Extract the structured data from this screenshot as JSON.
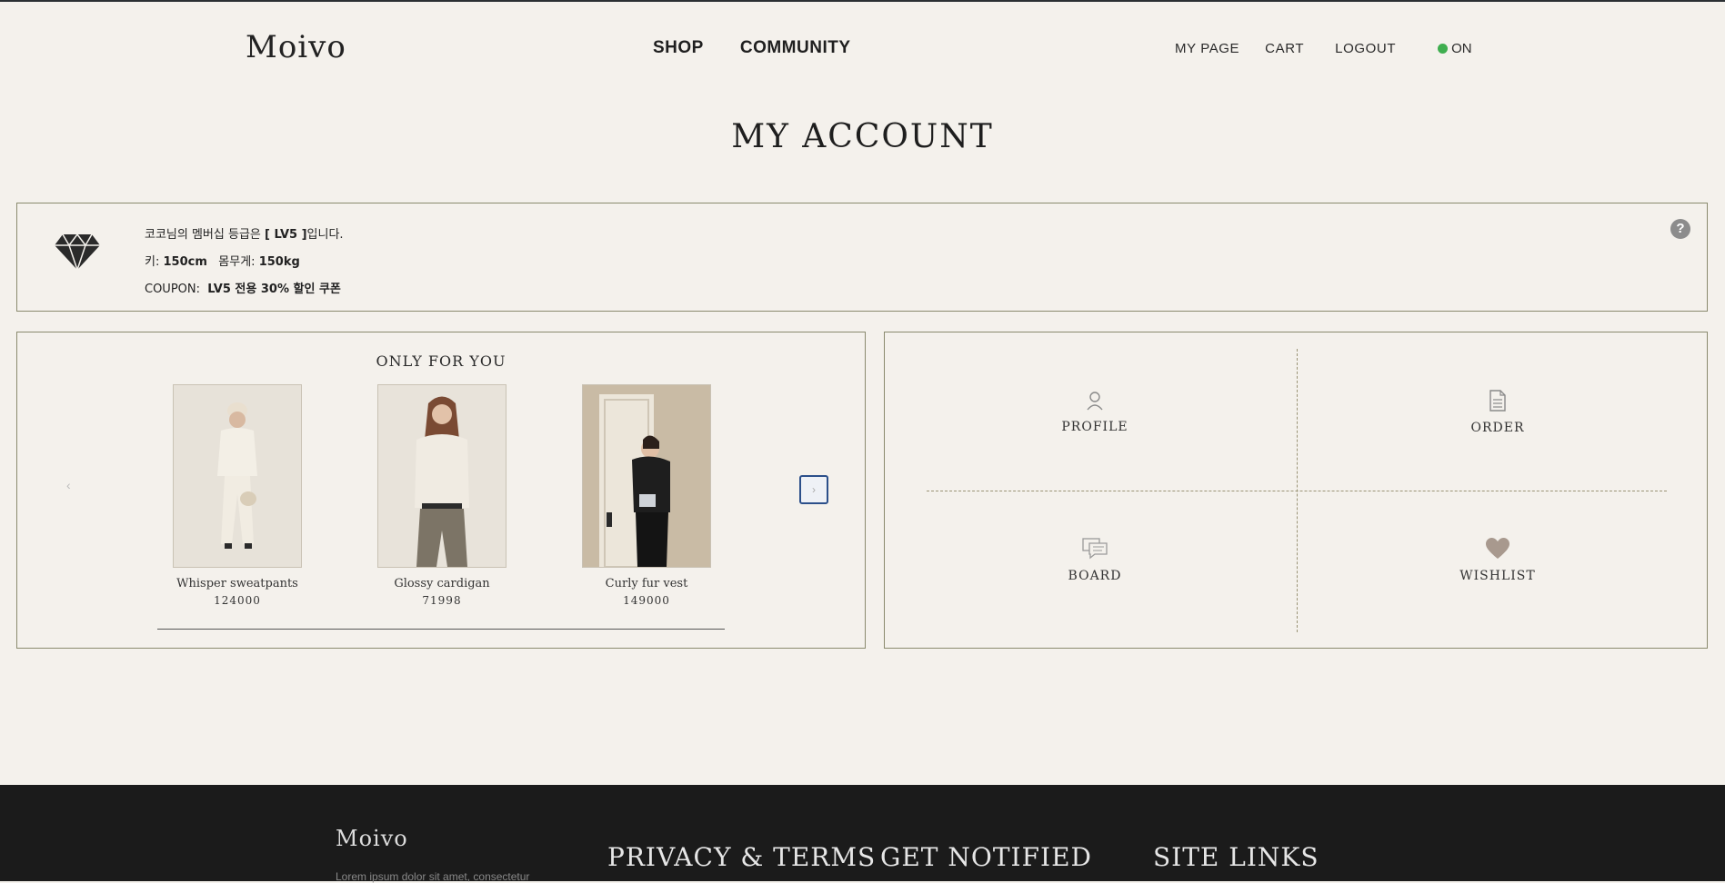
{
  "header": {
    "logo": "Moivo",
    "nav_main": [
      "SHOP",
      "COMMUNITY"
    ],
    "nav_right": {
      "my_page": "MY PAGE",
      "cart": "CART",
      "logout": "LOGOUT",
      "status": "ON"
    }
  },
  "page_title": "MY ACCOUNT",
  "membership": {
    "line1_prefix": "코코님의 멤버십 등급은 ",
    "level": "[ LV5 ]",
    "line1_suffix": "입니다.",
    "height_label": "키: ",
    "height_value": "150cm",
    "weight_label": "몸무게: ",
    "weight_value": "150kg",
    "coupon_label": "COUPON: ",
    "coupon_value": "LV5 전용 30% 할인 쿠폰",
    "help": "?"
  },
  "only_for_you": {
    "title": "ONLY FOR YOU",
    "products": [
      {
        "name": "Whisper sweatpants",
        "price": "124000"
      },
      {
        "name": "Glossy cardigan",
        "price": "71998"
      },
      {
        "name": "Curly fur vest",
        "price": "149000"
      }
    ]
  },
  "menu": {
    "profile": "PROFILE",
    "order": "ORDER",
    "board": "BOARD",
    "wishlist": "WISHLIST"
  },
  "footer": {
    "logo": "Moivo",
    "subtext": "Lorem ipsum dolor sit amet, consectetur",
    "headings": [
      "PRIVACY & TERMS",
      "GET NOTIFIED",
      "SITE LINKS"
    ]
  },
  "colors": {
    "background": "#f4f1ec",
    "border": "#8a8a6e",
    "footer": "#1b1b1b",
    "status_dot": "#3fae4f",
    "wishlist_heart": "#a8998e"
  }
}
